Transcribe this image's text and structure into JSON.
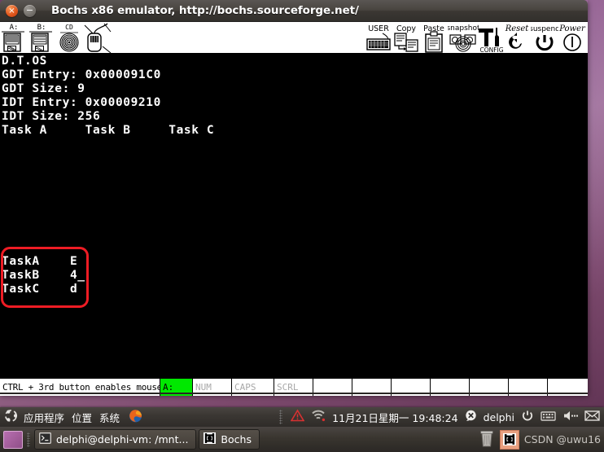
{
  "window": {
    "title": "Bochs x86 emulator, http://bochs.sourceforge.net/",
    "close_glyph": "×",
    "minimize_glyph": "−"
  },
  "toolbar": {
    "left_buttons": [
      {
        "name": "floppy-a-button",
        "label": "A:"
      },
      {
        "name": "floppy-b-button",
        "label": "B:"
      },
      {
        "name": "cdrom-button",
        "label": "CD"
      },
      {
        "name": "mouse-button",
        "label": ""
      }
    ],
    "right_buttons": [
      {
        "name": "user-button",
        "label": "USER"
      },
      {
        "name": "copy-button",
        "label": "Copy"
      },
      {
        "name": "paste-button",
        "label": "Paste"
      },
      {
        "name": "snapshot-button",
        "label": "snapshot"
      },
      {
        "name": "config-button",
        "label": "CONFIG"
      },
      {
        "name": "reset-button",
        "label": "Reset"
      },
      {
        "name": "suspend-button",
        "label": "suspend"
      },
      {
        "name": "power-button",
        "label": "Power"
      }
    ]
  },
  "vga": {
    "lines": [
      "D.T.OS",
      "GDT Entry: 0x000091C0",
      "GDT Size: 9",
      "IDT Entry: 0x00009210",
      "IDT Size: 256",
      "Task A     Task B     Task C"
    ],
    "task_lines": [
      "TaskA    E",
      "TaskB    4_",
      "TaskC    d"
    ],
    "annotation_color": "#ee1c24"
  },
  "statusbar": {
    "message": "CTRL + 3rd button enables mouse",
    "floppy_label": "A:",
    "floppy_color": "#00e800",
    "indicators": [
      "NUM",
      "CAPS",
      "SCRL"
    ]
  },
  "panel_top": {
    "menus": [
      "应用程序",
      "位置",
      "系统"
    ],
    "clock": "11月21日星期一 19:48:24",
    "user": "delphi"
  },
  "panel_bottom": {
    "tasks": [
      {
        "name": "task-terminal",
        "label": "delphi@delphi-vm: /mnt..."
      },
      {
        "name": "task-bochs",
        "label": "Bochs"
      }
    ],
    "watermark": "CSDN @uwu16"
  }
}
